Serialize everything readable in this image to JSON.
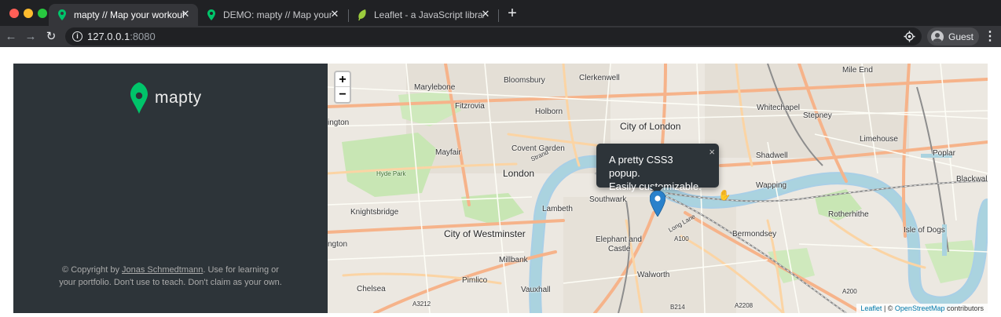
{
  "browser": {
    "tabs": [
      {
        "title": "mapty // Map your workouts",
        "active": true
      },
      {
        "title": "DEMO: mapty // Map your workouts",
        "active": false
      },
      {
        "title": "Leaflet - a JavaScript library for interactive maps",
        "active": false
      }
    ],
    "close_glyph": "✕",
    "new_tab_glyph": "+",
    "url_host": "127.0.0.1",
    "url_port": ":8080",
    "profile_name": "Guest",
    "icons": [
      "back-arrow-icon",
      "forward-arrow-icon",
      "reload-icon",
      "info-icon",
      "location-icon",
      "avatar-icon",
      "more-menu-icon"
    ]
  },
  "sidebar": {
    "logo_text": "mapty",
    "copyright_prefix": "© Copyright by ",
    "copyright_author": "Jonas Schmedtmann",
    "copyright_suffix": ". Use for learning or your portfolio. Don't use to teach. Don't claim as your own.",
    "accent_color": "#00c46a",
    "background_color": "#2d3439"
  },
  "map": {
    "zoom_in": "+",
    "zoom_out": "−",
    "popup": {
      "line1": "A pretty CSS3 popup.",
      "line2": "Easily customizable.",
      "close": "×"
    },
    "labels": {
      "marylebone": "Marylebone",
      "bloomsbury": "Bloomsbury",
      "clerkenwell": "Clerkenwell",
      "mile_end": "Mile End",
      "fitzrovia": "Fitzrovia",
      "holborn": "Holborn",
      "whitechapel": "Whitechapel",
      "stepney": "Stepney",
      "ington": "ington",
      "city_of_london": "City of London",
      "mayfair": "Mayfair",
      "covent_garden": "Covent Garden",
      "limehouse": "Limehouse",
      "shadwell": "Shadwell",
      "poplar": "Poplar",
      "hyde_park": "Hyde Park",
      "london": "London",
      "wapping": "Wapping",
      "blackwall": "Blackwall",
      "knightsbridge": "Knightsbridge",
      "lambeth": "Lambeth",
      "southwark": "Southwark",
      "rotherhithe": "Rotherhithe",
      "city_of_westminster": "City of Westminster",
      "elephant_and_castle_1": "Elephant and",
      "elephant_and_castle_2": "Castle",
      "bermondsey": "Bermondsey",
      "isle_of_dogs": "Isle of Dogs",
      "ington2": "ngton",
      "millbank": "Millbank",
      "pimlico": "Pimlico",
      "walworth": "Walworth",
      "chelsea": "Chelsea",
      "vauxhall": "Vauxhall",
      "a100": "A100",
      "a200": "A200",
      "a3212": "A3212",
      "b214": "B214",
      "a2208": "A2208",
      "long_lane": "Long Lane",
      "strand": "Strand"
    },
    "attribution": {
      "leaflet": "Leaflet",
      "sep": " | © ",
      "osm": "OpenStreetMap",
      "contributors": " contributors"
    }
  }
}
